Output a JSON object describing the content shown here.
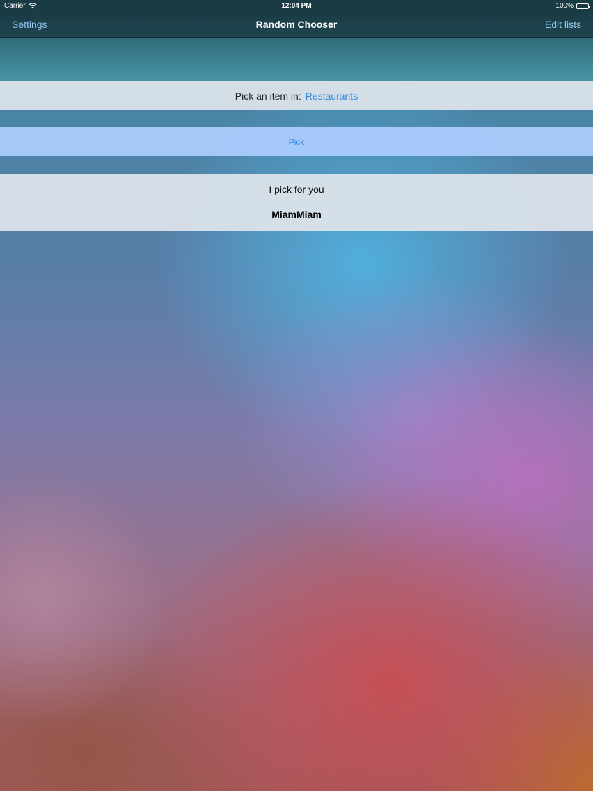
{
  "status_bar": {
    "carrier": "Carrier",
    "time": "12:04 PM",
    "battery": "100%",
    "battery_level": 1.0,
    "icons": [
      "wifi-icon",
      "battery-icon"
    ]
  },
  "nav": {
    "left_label": "Settings",
    "title": "Random Chooser",
    "right_label": "Edit lists"
  },
  "picker": {
    "label": "Pick an item in:",
    "list_name": "Restaurants"
  },
  "pick_button": {
    "label": "Pick"
  },
  "result": {
    "heading": "I pick for you",
    "value": "MiamMiam"
  },
  "colors": {
    "link": "#2f8be0",
    "nav_link": "#8cc8ef",
    "pick_button_bg": "#a8cafa",
    "row_bg": "#dee4eb"
  }
}
